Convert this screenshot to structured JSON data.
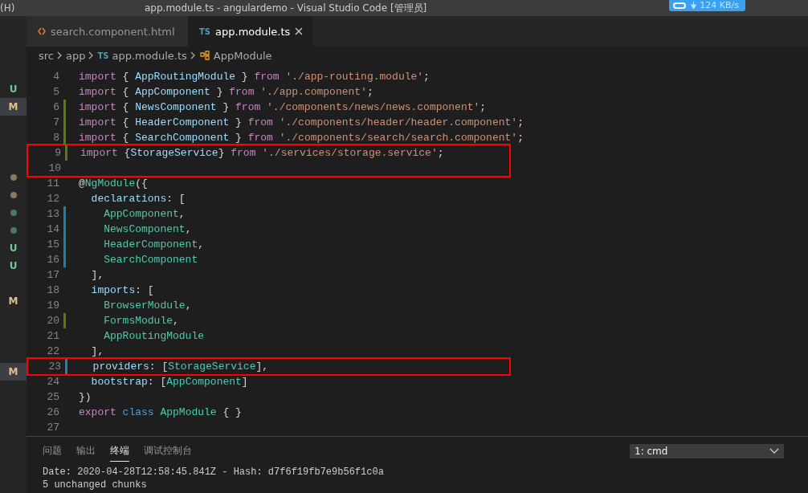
{
  "title_bar": {
    "menu_fragment": "(H)",
    "title": "app.module.ts - angulardemo - Visual Studio Code [管理员]",
    "net_speed": "124 KB/s"
  },
  "tabs": [
    {
      "label": "search.component.html",
      "kind": "html",
      "selected": false
    },
    {
      "label": "app.module.ts",
      "kind": "ts",
      "badge": "TS",
      "selected": true
    }
  ],
  "breadcrumbs": [
    {
      "label": "src",
      "kind": "folder"
    },
    {
      "label": "app",
      "kind": "folder"
    },
    {
      "label": "app.module.ts",
      "kind": "ts",
      "badge": "TS"
    },
    {
      "label": "AppModule",
      "kind": "symbol"
    }
  ],
  "explorer_marks": [
    {
      "kind": "letter",
      "text": "U",
      "color": "#73c991",
      "selected": false
    },
    {
      "kind": "letter",
      "text": "M",
      "color": "#e2c08d",
      "selected": true
    },
    {
      "kind": "blank"
    },
    {
      "kind": "blank"
    },
    {
      "kind": "blank"
    },
    {
      "kind": "dot",
      "color": "#8a7a5a"
    },
    {
      "kind": "dot",
      "color": "#8a7a5a"
    },
    {
      "kind": "dot",
      "color": "#4d7a5a"
    },
    {
      "kind": "dot",
      "color": "#4d7a5a"
    },
    {
      "kind": "letter",
      "text": "U",
      "color": "#73c991",
      "selected": false
    },
    {
      "kind": "letter",
      "text": "U",
      "color": "#73c991",
      "selected": false
    },
    {
      "kind": "blank"
    },
    {
      "kind": "letter",
      "text": "M",
      "color": "#e2c08d",
      "selected": false
    },
    {
      "kind": "blank"
    },
    {
      "kind": "blank"
    },
    {
      "kind": "blank"
    },
    {
      "kind": "letter",
      "text": "M",
      "color": "#e2c08d",
      "selected": true
    }
  ],
  "code_lines": [
    {
      "number": "4",
      "added": false,
      "modified": false,
      "highlight": false,
      "tokens": [
        {
          "kind": "keyword",
          "text": "import"
        },
        {
          "kind": "plain",
          "text": " { "
        },
        {
          "kind": "variable",
          "text": "AppRoutingModule"
        },
        {
          "kind": "plain",
          "text": " } "
        },
        {
          "kind": "keyword",
          "text": "from"
        },
        {
          "kind": "string",
          "text": " './app-routing.module'"
        },
        {
          "kind": "plain",
          "text": ";"
        }
      ]
    },
    {
      "number": "5",
      "added": false,
      "modified": false,
      "highlight": false,
      "tokens": [
        {
          "kind": "keyword",
          "text": "import"
        },
        {
          "kind": "plain",
          "text": " { "
        },
        {
          "kind": "variable",
          "text": "AppComponent"
        },
        {
          "kind": "plain",
          "text": " } "
        },
        {
          "kind": "keyword",
          "text": "from"
        },
        {
          "kind": "string",
          "text": " './app.component'"
        },
        {
          "kind": "plain",
          "text": ";"
        }
      ]
    },
    {
      "number": "6",
      "added": true,
      "modified": false,
      "highlight": false,
      "tokens": [
        {
          "kind": "keyword",
          "text": "import"
        },
        {
          "kind": "plain",
          "text": " { "
        },
        {
          "kind": "variable",
          "text": "NewsComponent"
        },
        {
          "kind": "plain",
          "text": " } "
        },
        {
          "kind": "keyword",
          "text": "from"
        },
        {
          "kind": "string",
          "text": " './components/news/news.component'"
        },
        {
          "kind": "plain",
          "text": ";"
        }
      ]
    },
    {
      "number": "7",
      "added": true,
      "modified": false,
      "highlight": false,
      "tokens": [
        {
          "kind": "keyword",
          "text": "import"
        },
        {
          "kind": "plain",
          "text": " { "
        },
        {
          "kind": "variable",
          "text": "HeaderComponent"
        },
        {
          "kind": "plain",
          "text": " } "
        },
        {
          "kind": "keyword",
          "text": "from"
        },
        {
          "kind": "string",
          "text": " './components/header/header.component'"
        },
        {
          "kind": "plain",
          "text": ";"
        }
      ]
    },
    {
      "number": "8",
      "added": true,
      "modified": false,
      "highlight": false,
      "tokens": [
        {
          "kind": "keyword",
          "text": "import"
        },
        {
          "kind": "plain",
          "text": " { "
        },
        {
          "kind": "variable",
          "text": "SearchComponent"
        },
        {
          "kind": "plain",
          "text": " } "
        },
        {
          "kind": "keyword",
          "text": "from"
        },
        {
          "kind": "string",
          "text": " './components/search/search.component'"
        },
        {
          "kind": "plain",
          "text": ";"
        }
      ]
    },
    {
      "number": "9",
      "added": true,
      "modified": false,
      "highlight": true,
      "tokens": [
        {
          "kind": "keyword",
          "text": "import"
        },
        {
          "kind": "plain",
          "text": " {"
        },
        {
          "kind": "variable",
          "text": "StorageService"
        },
        {
          "kind": "plain",
          "text": "} "
        },
        {
          "kind": "keyword",
          "text": "from"
        },
        {
          "kind": "string",
          "text": " './services/storage.service'"
        },
        {
          "kind": "plain",
          "text": ";"
        }
      ]
    },
    {
      "number": "10",
      "added": false,
      "modified": false,
      "highlight": true
    },
    {
      "number": "11",
      "added": false,
      "modified": false,
      "highlight": false,
      "tokens": [
        {
          "kind": "plain",
          "text": "@"
        },
        {
          "kind": "type",
          "text": "NgModule"
        },
        {
          "kind": "plain",
          "text": "({"
        }
      ]
    },
    {
      "number": "12",
      "added": false,
      "modified": false,
      "highlight": false,
      "tokens": [
        {
          "kind": "variable",
          "text": "  declarations"
        },
        {
          "kind": "plain",
          "text": ": ["
        }
      ]
    },
    {
      "number": "13",
      "added": false,
      "modified": true,
      "highlight": false,
      "tokens": [
        {
          "kind": "type",
          "text": "    AppComponent"
        },
        {
          "kind": "plain",
          "text": ","
        }
      ]
    },
    {
      "number": "14",
      "added": false,
      "modified": true,
      "highlight": false,
      "tokens": [
        {
          "kind": "type",
          "text": "    NewsComponent"
        },
        {
          "kind": "plain",
          "text": ","
        }
      ]
    },
    {
      "number": "15",
      "added": false,
      "modified": true,
      "highlight": false,
      "tokens": [
        {
          "kind": "type",
          "text": "    HeaderComponent"
        },
        {
          "kind": "plain",
          "text": ","
        }
      ]
    },
    {
      "number": "16",
      "added": false,
      "modified": true,
      "highlight": false,
      "tokens": [
        {
          "kind": "type",
          "text": "    SearchComponent"
        }
      ]
    },
    {
      "number": "17",
      "added": false,
      "modified": false,
      "highlight": false,
      "tokens": [
        {
          "kind": "plain",
          "text": "  ],"
        }
      ]
    },
    {
      "number": "18",
      "added": false,
      "modified": false,
      "highlight": false,
      "tokens": [
        {
          "kind": "variable",
          "text": "  imports"
        },
        {
          "kind": "plain",
          "text": ": ["
        }
      ]
    },
    {
      "number": "19",
      "added": false,
      "modified": false,
      "highlight": false,
      "tokens": [
        {
          "kind": "type",
          "text": "    BrowserModule"
        },
        {
          "kind": "plain",
          "text": ","
        }
      ]
    },
    {
      "number": "20",
      "added": true,
      "modified": false,
      "highlight": false,
      "tokens": [
        {
          "kind": "type",
          "text": "    FormsModule"
        },
        {
          "kind": "plain",
          "text": ","
        }
      ]
    },
    {
      "number": "21",
      "added": false,
      "modified": false,
      "highlight": false,
      "tokens": [
        {
          "kind": "type",
          "text": "    AppRoutingModule"
        }
      ]
    },
    {
      "number": "22",
      "added": false,
      "modified": false,
      "highlight": false,
      "tokens": [
        {
          "kind": "plain",
          "text": "  ],"
        }
      ]
    },
    {
      "number": "23",
      "added": false,
      "modified": true,
      "highlight": true,
      "tokens": [
        {
          "kind": "variable",
          "text": "  providers"
        },
        {
          "kind": "plain",
          "text": ": ["
        },
        {
          "kind": "type",
          "text": "StorageService"
        },
        {
          "kind": "plain",
          "text": "],"
        }
      ]
    },
    {
      "number": "24",
      "added": false,
      "modified": false,
      "highlight": false,
      "tokens": [
        {
          "kind": "variable",
          "text": "  bootstrap"
        },
        {
          "kind": "plain",
          "text": ": ["
        },
        {
          "kind": "type",
          "text": "AppComponent"
        },
        {
          "kind": "plain",
          "text": "]"
        }
      ]
    },
    {
      "number": "25",
      "added": false,
      "modified": false,
      "highlight": false,
      "tokens": [
        {
          "kind": "plain",
          "text": "})"
        }
      ]
    },
    {
      "number": "26",
      "added": false,
      "modified": false,
      "highlight": false,
      "tokens": [
        {
          "kind": "keyword",
          "text": "export"
        },
        {
          "kind": "storage",
          "text": " class"
        },
        {
          "kind": "type",
          "text": " AppModule"
        },
        {
          "kind": "plain",
          "text": " { }"
        }
      ]
    },
    {
      "number": "27",
      "added": false,
      "modified": false,
      "highlight": false
    }
  ],
  "panel": {
    "tabs": [
      {
        "label": "问题",
        "selected": false
      },
      {
        "label": "输出",
        "selected": false
      },
      {
        "label": "终端",
        "selected": true
      },
      {
        "label": "调试控制台",
        "selected": false
      }
    ],
    "terminal_select": "1: cmd",
    "terminal_lines": [
      "Date: 2020-04-28T12:58:45.841Z - Hash: d7f6f19fb7e9b56f1c0a",
      "5 unchanged chunks"
    ]
  }
}
